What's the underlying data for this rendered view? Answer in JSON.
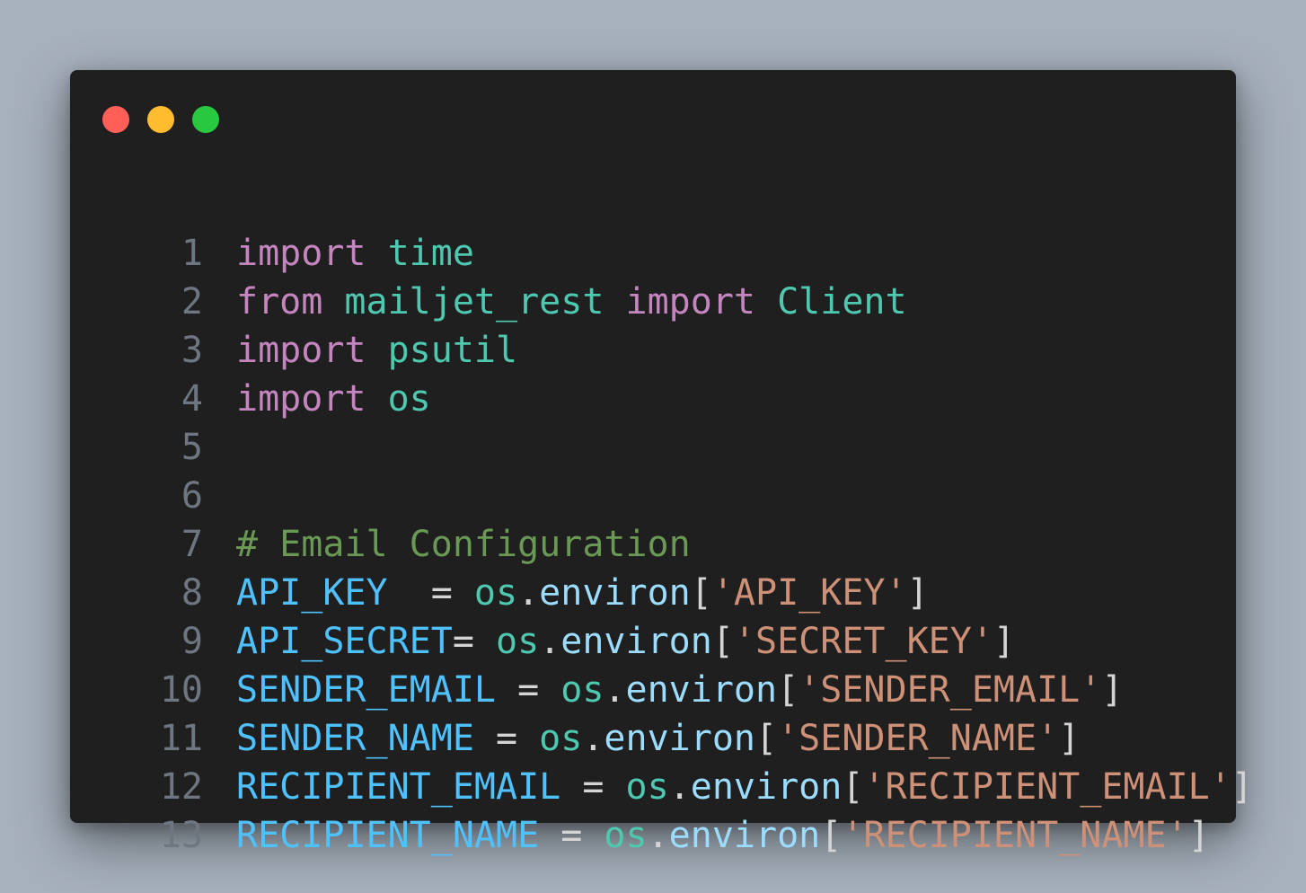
{
  "window": {
    "controls": [
      {
        "name": "close",
        "color": "#ff5f57"
      },
      {
        "name": "minimize",
        "color": "#febc2e"
      },
      {
        "name": "maximize",
        "color": "#28c840"
      }
    ]
  },
  "colors": {
    "keyword": "#c586c0",
    "module": "#4ec9b0",
    "comment": "#6a9955",
    "variable": "#4fc1ff",
    "property": "#9cdcfe",
    "string": "#ce9178",
    "punct": "#d4d4d4",
    "line_number": "#6e7681"
  },
  "code": {
    "lines": [
      {
        "number": "1",
        "tokens": [
          {
            "t": "import",
            "k": "keyword"
          },
          {
            "t": " ",
            "k": "punct"
          },
          {
            "t": "time",
            "k": "module"
          }
        ]
      },
      {
        "number": "2",
        "tokens": [
          {
            "t": "from",
            "k": "keyword"
          },
          {
            "t": " ",
            "k": "punct"
          },
          {
            "t": "mailjet_rest",
            "k": "module"
          },
          {
            "t": " ",
            "k": "punct"
          },
          {
            "t": "import",
            "k": "keyword"
          },
          {
            "t": " ",
            "k": "punct"
          },
          {
            "t": "Client",
            "k": "module"
          }
        ]
      },
      {
        "number": "3",
        "tokens": [
          {
            "t": "import",
            "k": "keyword"
          },
          {
            "t": " ",
            "k": "punct"
          },
          {
            "t": "psutil",
            "k": "module"
          }
        ]
      },
      {
        "number": "4",
        "tokens": [
          {
            "t": "import",
            "k": "keyword"
          },
          {
            "t": " ",
            "k": "punct"
          },
          {
            "t": "os",
            "k": "module"
          }
        ]
      },
      {
        "number": "5",
        "tokens": []
      },
      {
        "number": "6",
        "tokens": []
      },
      {
        "number": "7",
        "tokens": [
          {
            "t": "# Email Configuration",
            "k": "comment"
          }
        ]
      },
      {
        "number": "8",
        "tokens": [
          {
            "t": "API_KEY",
            "k": "variable"
          },
          {
            "t": "  = ",
            "k": "punct"
          },
          {
            "t": "os",
            "k": "module"
          },
          {
            "t": ".",
            "k": "punct"
          },
          {
            "t": "environ",
            "k": "property"
          },
          {
            "t": "[",
            "k": "punct"
          },
          {
            "t": "'API_KEY'",
            "k": "string"
          },
          {
            "t": "]",
            "k": "punct"
          }
        ]
      },
      {
        "number": "9",
        "tokens": [
          {
            "t": "API_SECRET",
            "k": "variable"
          },
          {
            "t": "= ",
            "k": "punct"
          },
          {
            "t": "os",
            "k": "module"
          },
          {
            "t": ".",
            "k": "punct"
          },
          {
            "t": "environ",
            "k": "property"
          },
          {
            "t": "[",
            "k": "punct"
          },
          {
            "t": "'SECRET_KEY'",
            "k": "string"
          },
          {
            "t": "]",
            "k": "punct"
          }
        ]
      },
      {
        "number": "10",
        "tokens": [
          {
            "t": "SENDER_EMAIL",
            "k": "variable"
          },
          {
            "t": " = ",
            "k": "punct"
          },
          {
            "t": "os",
            "k": "module"
          },
          {
            "t": ".",
            "k": "punct"
          },
          {
            "t": "environ",
            "k": "property"
          },
          {
            "t": "[",
            "k": "punct"
          },
          {
            "t": "'SENDER_EMAIL'",
            "k": "string"
          },
          {
            "t": "]",
            "k": "punct"
          }
        ]
      },
      {
        "number": "11",
        "tokens": [
          {
            "t": "SENDER_NAME",
            "k": "variable"
          },
          {
            "t": " = ",
            "k": "punct"
          },
          {
            "t": "os",
            "k": "module"
          },
          {
            "t": ".",
            "k": "punct"
          },
          {
            "t": "environ",
            "k": "property"
          },
          {
            "t": "[",
            "k": "punct"
          },
          {
            "t": "'SENDER_NAME'",
            "k": "string"
          },
          {
            "t": "]",
            "k": "punct"
          }
        ]
      },
      {
        "number": "12",
        "tokens": [
          {
            "t": "RECIPIENT_EMAIL",
            "k": "variable"
          },
          {
            "t": " = ",
            "k": "punct"
          },
          {
            "t": "os",
            "k": "module"
          },
          {
            "t": ".",
            "k": "punct"
          },
          {
            "t": "environ",
            "k": "property"
          },
          {
            "t": "[",
            "k": "punct"
          },
          {
            "t": "'RECIPIENT_EMAIL'",
            "k": "string"
          },
          {
            "t": "]",
            "k": "punct"
          }
        ]
      },
      {
        "number": "13",
        "tokens": [
          {
            "t": "RECIPIENT_NAME",
            "k": "variable"
          },
          {
            "t": " = ",
            "k": "punct"
          },
          {
            "t": "os",
            "k": "module"
          },
          {
            "t": ".",
            "k": "punct"
          },
          {
            "t": "environ",
            "k": "property"
          },
          {
            "t": "[",
            "k": "punct"
          },
          {
            "t": "'RECIPIENT_NAME'",
            "k": "string"
          },
          {
            "t": "]",
            "k": "punct"
          }
        ]
      }
    ]
  }
}
